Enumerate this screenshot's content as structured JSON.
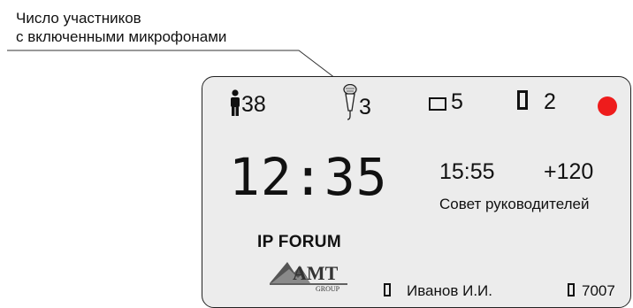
{
  "callout": {
    "line1": "Число участников",
    "line2": "с включенными микрофонами"
  },
  "stats": {
    "participants": "38",
    "microphones": "3",
    "screens": "5",
    "devices": "2"
  },
  "recording": {
    "color": "#ee1c1c"
  },
  "clock": {
    "current_time": "12:35",
    "end_time": "15:55",
    "delta": "+120"
  },
  "event": {
    "title": "Совет руководителей"
  },
  "brand": {
    "name": "IP FORUM",
    "logo_text": "AMT",
    "logo_sub": "GROUP"
  },
  "user": {
    "name": "Иванов И.И.",
    "id": "7007"
  },
  "icons": [
    "person-icon",
    "microphone-icon",
    "screen-icon",
    "device-icon",
    "recording-indicator",
    "amt-group-logo"
  ]
}
